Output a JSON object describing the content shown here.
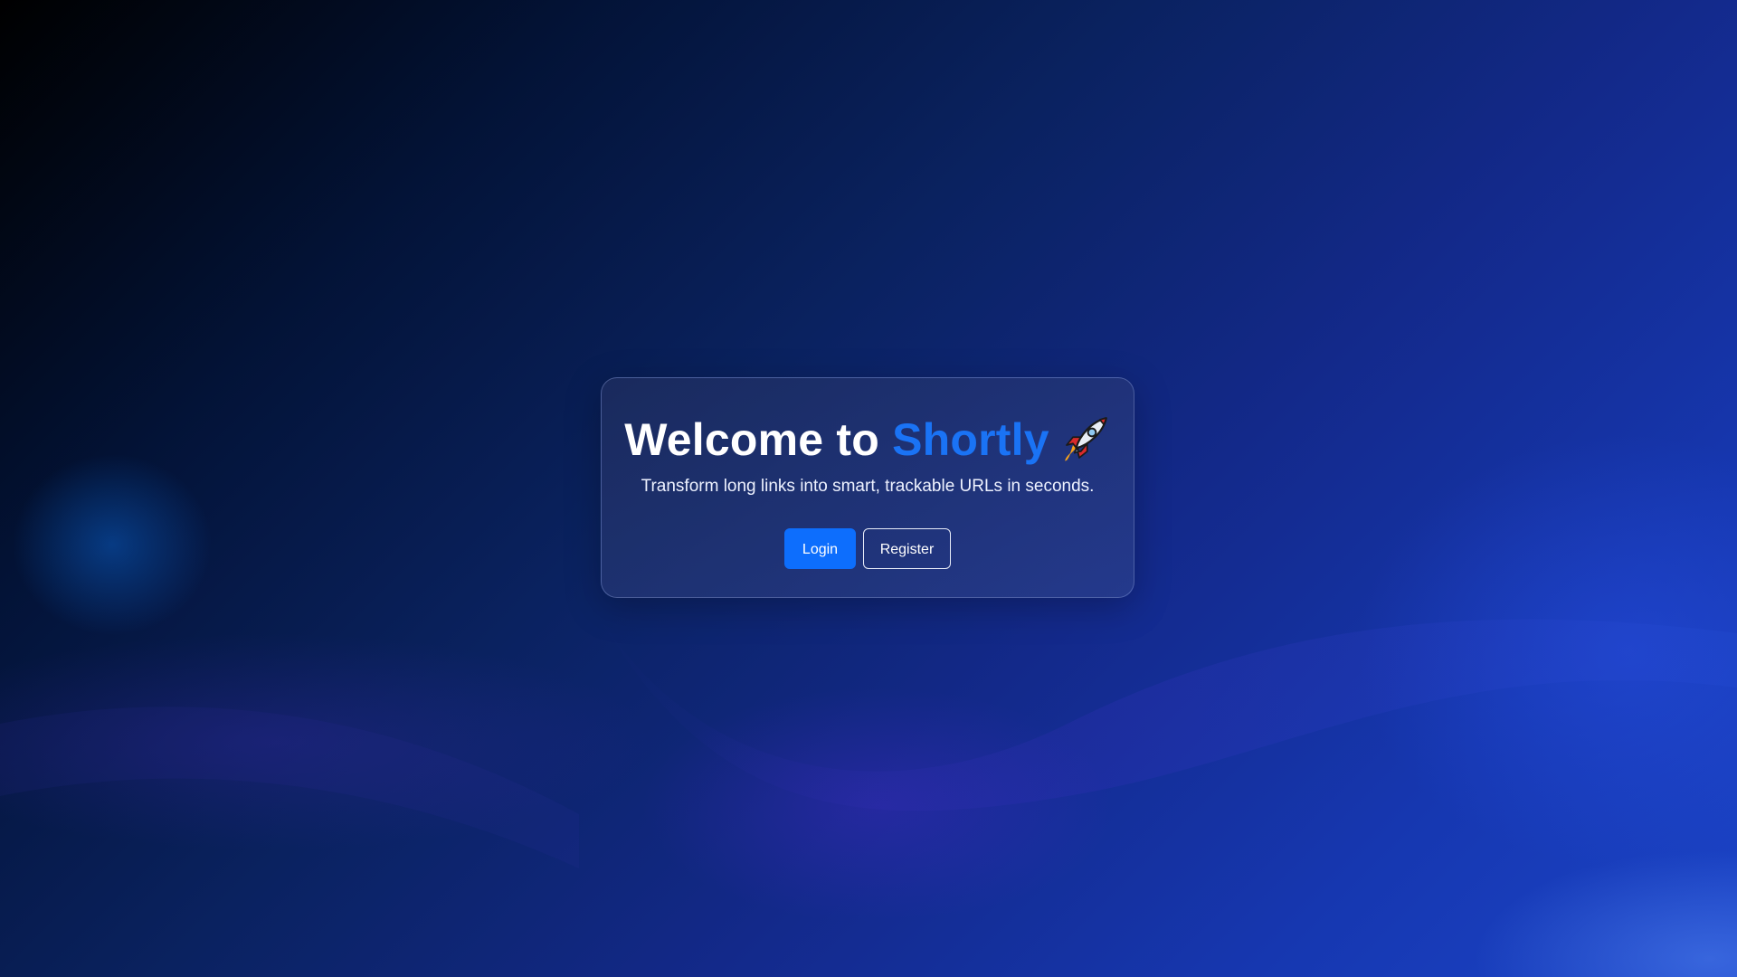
{
  "hero": {
    "title_prefix": "Welcome to ",
    "title_brand": "Shortly",
    "title_icon": "rocket-icon",
    "subtitle": "Transform long links into smart, trackable URLs in seconds."
  },
  "actions": {
    "login_label": "Login",
    "register_label": "Register"
  },
  "colors": {
    "brand": "#1a73f5",
    "primary_button": "#0d6efd",
    "background_dark": "#000000",
    "background_light": "#1b44c8"
  }
}
